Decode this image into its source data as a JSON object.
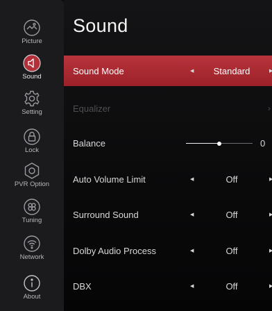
{
  "sidebar": {
    "items": [
      {
        "label": "Picture",
        "icon": "picture-icon"
      },
      {
        "label": "Sound",
        "icon": "speaker-icon",
        "active": true
      },
      {
        "label": "Setting",
        "icon": "gear-icon"
      },
      {
        "label": "Lock",
        "icon": "lock-icon"
      },
      {
        "label": "PVR Option",
        "icon": "pvr-icon"
      },
      {
        "label": "Tuning",
        "icon": "tuning-icon"
      },
      {
        "label": "Network",
        "icon": "network-icon"
      },
      {
        "label": "About",
        "icon": "info-icon"
      }
    ]
  },
  "main": {
    "title": "Sound",
    "rows": [
      {
        "label": "Sound Mode",
        "value": "Standard"
      },
      {
        "label": "Equalizer"
      },
      {
        "label": "Balance",
        "value": "0",
        "level": 0.5
      },
      {
        "label": "Auto Volume Limit",
        "value": "Off"
      },
      {
        "label": "Surround Sound",
        "value": "Off"
      },
      {
        "label": "Dolby Audio Process",
        "value": "Off"
      },
      {
        "label": "DBX",
        "value": "Off"
      }
    ]
  },
  "glyphs": {
    "arrow_left": "◀",
    "arrow_right": "▶",
    "chevron": "›"
  },
  "colors": {
    "accent": "#b1303a",
    "sidebar": "#1b1b1e",
    "background": "#0b0b0d"
  }
}
